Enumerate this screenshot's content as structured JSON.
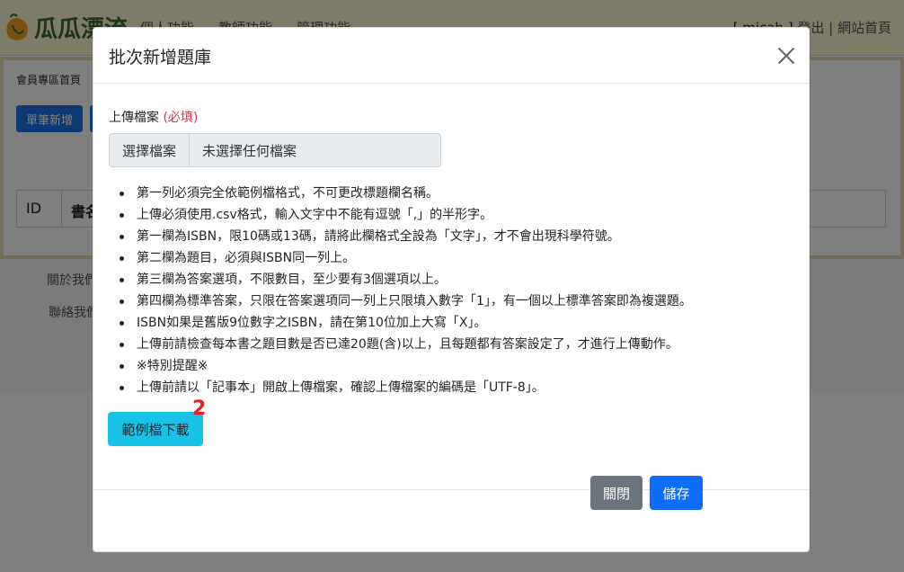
{
  "background": {
    "brand": {
      "name": "瓜瓜漂流"
    },
    "nav": {
      "items": [
        "個人功能",
        "教師功能",
        "管理功能"
      ]
    },
    "user": {
      "name": "[ micah ]",
      "logout": "登出",
      "separator": "|",
      "home": "網站首頁"
    },
    "breadcrumb": "會員專區首頁",
    "add_button": "單筆新增",
    "table": {
      "headers": [
        "ID",
        "書名"
      ]
    },
    "footer": {
      "about": "關於我們",
      "contact": "聯絡我們"
    }
  },
  "modal": {
    "title": "批次新增題庫",
    "field_label": "上傳檔案",
    "required": "(必填)",
    "file_button": "選擇檔案",
    "file_status": "未選擇任何檔案",
    "notes": [
      "第一列必須完全依範例檔格式，不可更改標題欄名稱。",
      "上傳必須使用.csv格式，輸入文字中不能有逗號「,」的半形字。",
      "第一欄為ISBN，限10碼或13碼，請將此欄格式全設為「文字」，才不會出現科學符號。",
      "第二欄為題目，必須與ISBN同一列上。",
      "第三欄為答案選項，不限數目，至少要有3個選項以上。",
      "第四欄為標準答案，只限在答案選項同一列上只限填入數字「1」，有一個以上標準答案即為複選題。",
      "ISBN如果是舊版9位數字之ISBN，請在第10位加上大寫「X」。",
      "上傳前請檢查每本書之題目數是否已達20題(含)以上，且每題都有答案設定了，才進行上傳動作。",
      "※特別提醒※",
      "上傳前請以「記事本」開啟上傳檔案，確認上傳檔案的編碼是「UTF-8」。"
    ],
    "sample_button": "範例檔下載",
    "annotation_marker": "2",
    "close_button": "關閉",
    "save_button": "儲存"
  },
  "colors": {
    "primary": "#0d6efd",
    "secondary": "#6c757d",
    "info": "#17c1e8",
    "required": "#dc3545",
    "marker": "#e8211c",
    "navbar": "#fdf6d2"
  }
}
